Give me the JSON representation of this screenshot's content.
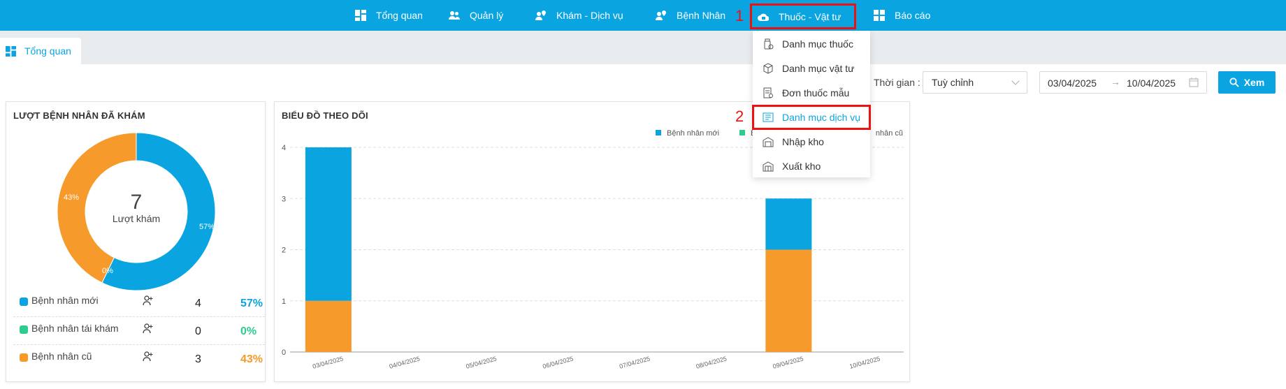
{
  "nav": {
    "items": [
      {
        "label": "Tổng quan",
        "icon": "dashboard-icon"
      },
      {
        "label": "Quản lý",
        "icon": "users-icon"
      },
      {
        "label": "Khám - Dịch vụ",
        "icon": "user-location-icon"
      },
      {
        "label": "Bệnh Nhân",
        "icon": "patient-icon"
      },
      {
        "label": "Thuốc - Vật tư",
        "icon": "medicine-cloud-icon"
      },
      {
        "label": "Báo cáo",
        "icon": "report-grid-icon"
      }
    ]
  },
  "tab": {
    "label": "Tổng quan"
  },
  "filter": {
    "time_label": "Thời gian :",
    "range_type": "Tuỳ chỉnh",
    "date_from": "03/04/2025",
    "date_to": "10/04/2025",
    "view_button": "Xem"
  },
  "visits": {
    "title": "LƯỢT BỆNH NHÂN ĐÃ KHÁM",
    "total": "7",
    "total_label": "Lượt khám",
    "slice_labels": {
      "new": "57%",
      "old": "43%",
      "returning": "0%"
    },
    "rows": [
      {
        "label": "Bệnh nhân mới",
        "count": "4",
        "percent": "57%",
        "color": "#0aa5e1"
      },
      {
        "label": "Bệnh nhân tái khám",
        "count": "0",
        "percent": "0%",
        "color": "#2ecc8f"
      },
      {
        "label": "Bệnh nhân cũ",
        "count": "3",
        "percent": "43%",
        "color": "#f59a2b"
      }
    ]
  },
  "chart": {
    "title": "BIỂU ĐỒ THEO DÕI",
    "legend_visible": [
      "Bệnh nhân mới",
      "B",
      "nhân cũ"
    ]
  },
  "chart_data": {
    "type": "bar",
    "stacked": true,
    "categories": [
      "03/04/2025",
      "04/04/2025",
      "05/04/2025",
      "06/04/2025",
      "07/04/2025",
      "08/04/2025",
      "09/04/2025",
      "10/04/2025"
    ],
    "series": [
      {
        "name": "Bệnh nhân cũ",
        "color": "#f59a2b",
        "values": [
          1,
          0,
          0,
          0,
          0,
          0,
          2,
          0
        ]
      },
      {
        "name": "Bệnh nhân mới",
        "color": "#0aa5e1",
        "values": [
          3,
          0,
          0,
          0,
          0,
          0,
          1,
          0
        ]
      }
    ],
    "yticks": [
      "0",
      "1",
      "2",
      "3",
      "4"
    ],
    "ylim": [
      0,
      4
    ],
    "grid": true,
    "legend_position": "top-right"
  },
  "dropdown": {
    "items": [
      {
        "label": "Danh mục thuốc",
        "icon": "pill-bottle-icon"
      },
      {
        "label": "Danh mục vật tư",
        "icon": "box-icon"
      },
      {
        "label": "Đơn thuốc mẫu",
        "icon": "prescription-icon"
      },
      {
        "label": "Danh mục dịch vụ",
        "icon": "service-list-icon"
      },
      {
        "label": "Nhập kho",
        "icon": "warehouse-in-icon"
      },
      {
        "label": "Xuất kho",
        "icon": "warehouse-out-icon"
      }
    ]
  },
  "annotations": {
    "step1": "1",
    "step2": "2"
  }
}
